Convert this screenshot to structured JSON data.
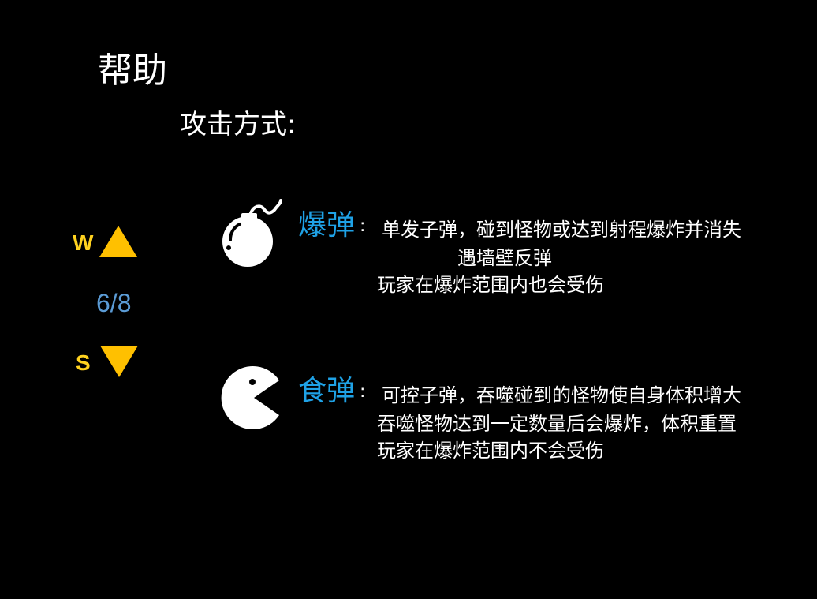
{
  "help": {
    "title": "帮助",
    "subtitle": "攻击方式:"
  },
  "navigation": {
    "up_key": "W",
    "down_key": "S",
    "page": "6/8",
    "up_icon": "triangle-up-icon",
    "down_icon": "triangle-down-icon"
  },
  "weapons": [
    {
      "name": "爆弹",
      "colon": ":",
      "icon": "bomb-icon",
      "lines": [
        "单发子弹，碰到怪物或达到射程爆炸并消失",
        "遇墙壁反弹",
        "玩家在爆炸范围内也会受伤"
      ]
    },
    {
      "name": "食弹",
      "colon": ":",
      "icon": "pacman-icon",
      "lines": [
        "可控子弹，吞噬碰到的怪物使自身体积增大",
        "吞噬怪物达到一定数量后会爆炸，体积重置",
        "玩家在爆炸范围内不会受伤"
      ]
    }
  ],
  "colors": {
    "background": "#000000",
    "key_yellow": "#ffd21f",
    "arrow_orange": "#ffc000",
    "page_blue": "#5b9bd5",
    "weapon_blue": "#1fa2e6",
    "text": "#ffffff"
  }
}
